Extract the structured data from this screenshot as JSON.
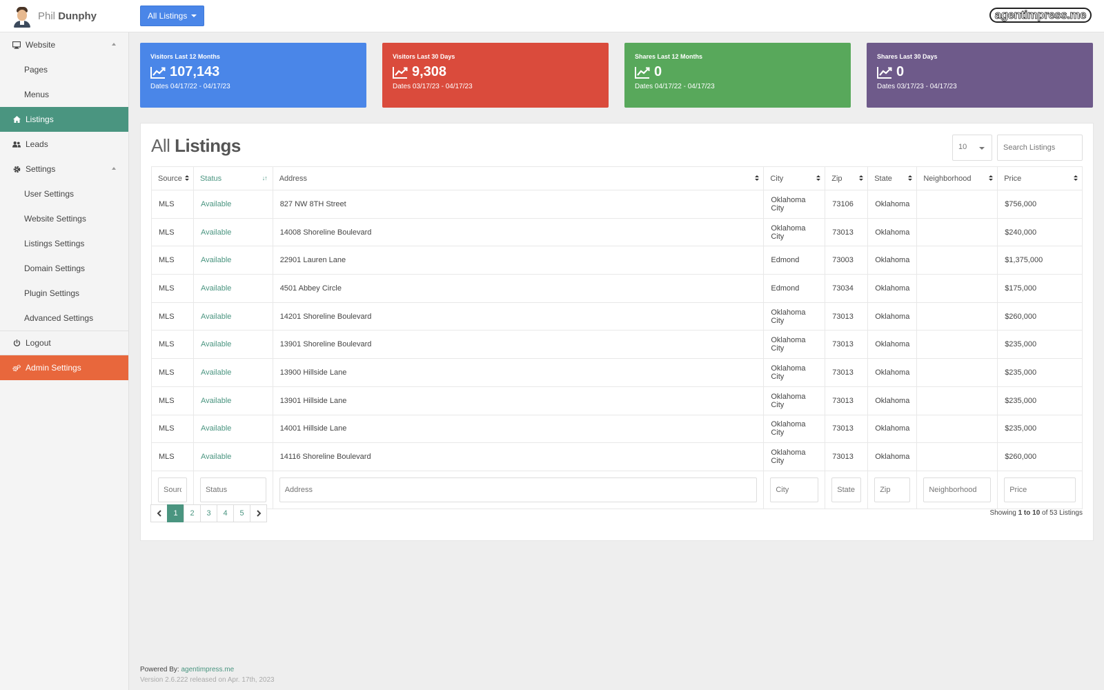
{
  "user": {
    "first_name": "Phil",
    "last_name": "Dunphy"
  },
  "header": {
    "listing_filter": "All Listings",
    "logo_text": "agentimpress.me"
  },
  "sidebar": {
    "website": "Website",
    "pages": "Pages",
    "menus": "Menus",
    "listings": "Listings",
    "leads": "Leads",
    "settings": "Settings",
    "user_settings": "User Settings",
    "website_settings": "Website Settings",
    "listings_settings": "Listings Settings",
    "domain_settings": "Domain Settings",
    "plugin_settings": "Plugin Settings",
    "advanced_settings": "Advanced Settings",
    "logout": "Logout",
    "admin_settings": "Admin Settings"
  },
  "stats": [
    {
      "label": "Visitors Last 12 Months",
      "value": "107,143",
      "dates": "Dates 04/17/22 - 04/17/23",
      "color": "#4a86e8"
    },
    {
      "label": "Visitors Last 30 Days",
      "value": "9,308",
      "dates": "Dates 03/17/23 - 04/17/23",
      "color": "#da4b3c"
    },
    {
      "label": "Shares Last 12 Months",
      "value": "0",
      "dates": "Dates 04/17/22 - 04/17/23",
      "color": "#58a85b"
    },
    {
      "label": "Shares Last 30 Days",
      "value": "0",
      "dates": "Dates 03/17/23 - 04/17/23",
      "color": "#6e5a8a"
    }
  ],
  "panel": {
    "title_light": "All",
    "title_bold": "Listings",
    "per_page": "10",
    "search_placeholder": "Search Listings"
  },
  "table": {
    "columns": [
      "Source",
      "Status",
      "Address",
      "City",
      "Zip",
      "State",
      "Neighborhood",
      "Price"
    ],
    "rows": [
      [
        "MLS",
        "Available",
        "827 NW 8TH Street",
        "Oklahoma City",
        "73106",
        "Oklahoma",
        "",
        "$756,000"
      ],
      [
        "MLS",
        "Available",
        "14008 Shoreline Boulevard",
        "Oklahoma City",
        "73013",
        "Oklahoma",
        "",
        "$240,000"
      ],
      [
        "MLS",
        "Available",
        "22901 Lauren Lane",
        "Edmond",
        "73003",
        "Oklahoma",
        "",
        "$1,375,000"
      ],
      [
        "MLS",
        "Available",
        "4501 Abbey Circle",
        "Edmond",
        "73034",
        "Oklahoma",
        "",
        "$175,000"
      ],
      [
        "MLS",
        "Available",
        "14201 Shoreline Boulevard",
        "Oklahoma City",
        "73013",
        "Oklahoma",
        "",
        "$260,000"
      ],
      [
        "MLS",
        "Available",
        "13901 Shoreline Boulevard",
        "Oklahoma City",
        "73013",
        "Oklahoma",
        "",
        "$235,000"
      ],
      [
        "MLS",
        "Available",
        "13900 Hillside Lane",
        "Oklahoma City",
        "73013",
        "Oklahoma",
        "",
        "$235,000"
      ],
      [
        "MLS",
        "Available",
        "13901 Hillside Lane",
        "Oklahoma City",
        "73013",
        "Oklahoma",
        "",
        "$235,000"
      ],
      [
        "MLS",
        "Available",
        "14001 Hillside Lane",
        "Oklahoma City",
        "73013",
        "Oklahoma",
        "",
        "$235,000"
      ],
      [
        "MLS",
        "Available",
        "14116 Shoreline Boulevard",
        "Oklahoma City",
        "73013",
        "Oklahoma",
        "",
        "$260,000"
      ]
    ],
    "filter_placeholders": [
      "Sourc",
      "Status",
      "Address",
      "City",
      "State",
      "Zip",
      "Neighborhood",
      "Price"
    ]
  },
  "pagination": {
    "pages": [
      "1",
      "2",
      "3",
      "4",
      "5"
    ],
    "current": "1",
    "showing_prefix": "Showing ",
    "showing_range": "1 to 10",
    "showing_suffix": " of 53 Listings"
  },
  "footer": {
    "powered_by": "Powered By: ",
    "powered_link": "agentimpress.me",
    "version": "Version 2.6.222 released on Apr. 17th, 2023"
  },
  "colors": {
    "accent": "#4a9580",
    "admin": "#e8673c",
    "primary": "#4a86e8"
  }
}
